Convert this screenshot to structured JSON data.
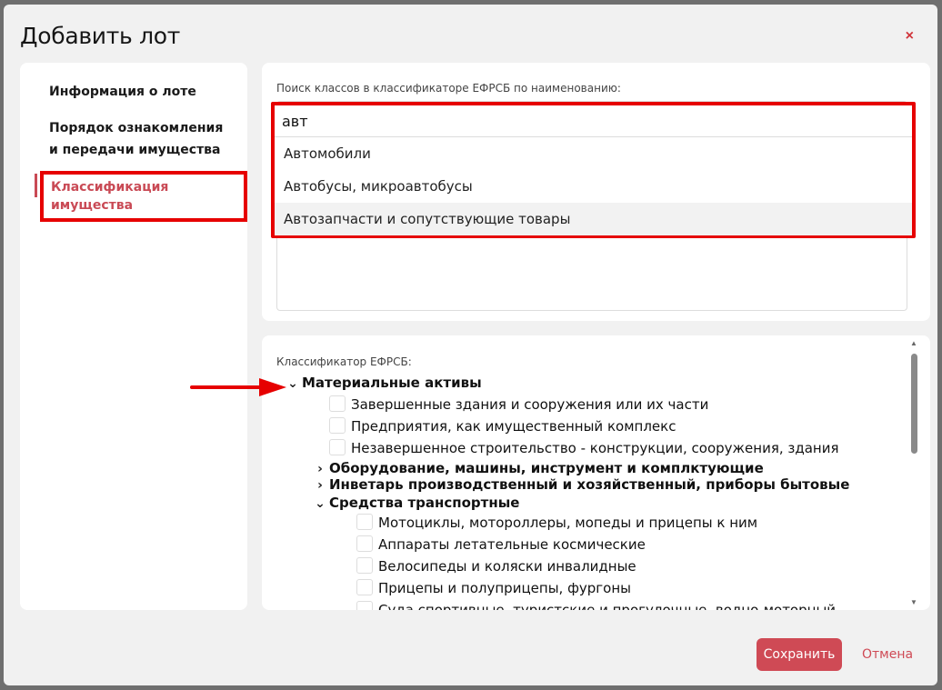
{
  "modal": {
    "title": "Добавить лот",
    "close_icon": "×"
  },
  "sidebar": {
    "items": [
      {
        "label": "Информация о лоте"
      },
      {
        "label": "Порядок ознакомления и передачи имущества"
      },
      {
        "label": "Классификация имущества",
        "active": true
      }
    ]
  },
  "search": {
    "label": "Поиск классов в классификаторе ЕФРСБ по наименованию:",
    "value": "авт",
    "results": [
      "Автомобили",
      "Автобусы, микроавтобусы",
      "Автозапчасти и сопутствующие товары"
    ]
  },
  "classifier": {
    "label": "Классификатор ЕФРСБ:",
    "root": {
      "label": "Материальные активы",
      "expanded": true,
      "leaves": [
        "Завершенные здания и сооружения или их части",
        "Предприятия, как имущественный комплекс",
        "Незавершенное строительство - конструкции, сооружения, здания"
      ],
      "groups": [
        {
          "label": "Оборудование, машины, инструмент и комплктующие",
          "expanded": false
        },
        {
          "label": "Инветарь производственный и хозяйственный, приборы бытовые",
          "expanded": false
        },
        {
          "label": "Средства транспортные",
          "expanded": true
        }
      ],
      "transport_leaves": [
        "Мотоциклы, мотороллеры, мопеды и прицепы к ним",
        "Аппараты летательные космические",
        "Велосипеды и коляски инвалидные",
        "Прицепы и полуприцепы, фургоны",
        "Суда спортивные, туристские и прогулочные, водно-моторный"
      ]
    }
  },
  "footer": {
    "save_label": "Сохранить",
    "cancel_label": "Отмена"
  },
  "colors": {
    "accent": "#cf4a55",
    "highlight": "#e60000"
  }
}
